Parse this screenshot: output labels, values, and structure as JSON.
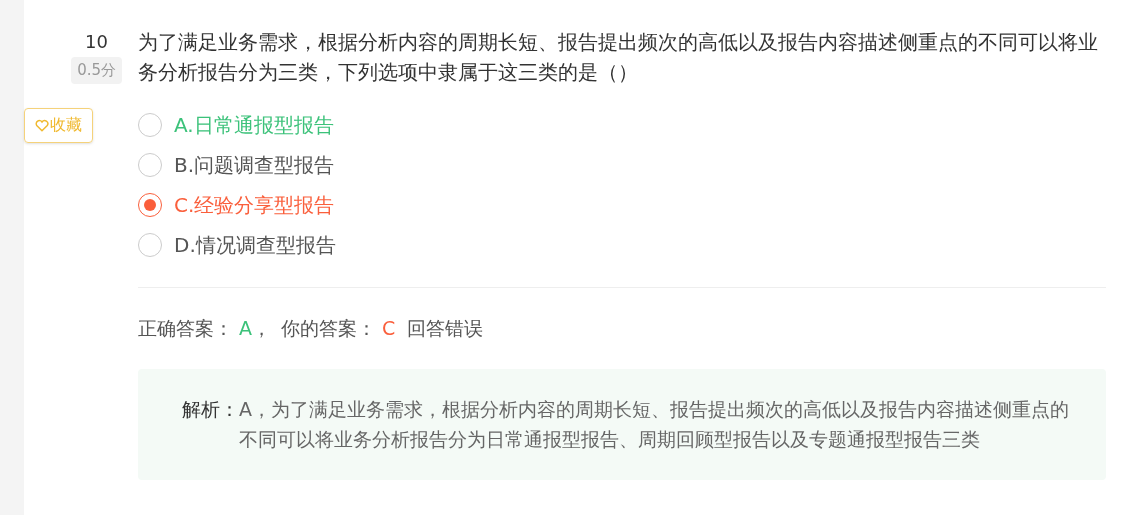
{
  "question": {
    "number": "10",
    "score": "0.5分",
    "text": "为了满足业务需求，根据分析内容的周期长短、报告提出频次的高低以及报告内容描述侧重点的不同可以将业务分析报告分为三类，下列选项中隶属于这三类的是（）"
  },
  "favorite_button": {
    "label": "收藏"
  },
  "options": [
    {
      "label": "A.日常通报型报告",
      "selected": false,
      "correct": true
    },
    {
      "label": "B.问题调查型报告",
      "selected": false,
      "correct": false
    },
    {
      "label": "C.经验分享型报告",
      "selected": true,
      "correct": false
    },
    {
      "label": "D.情况调查型报告",
      "selected": false,
      "correct": false
    }
  ],
  "result": {
    "correct_label": "正确答案：",
    "correct_answer": "A",
    "separator": "，",
    "your_label": "你的答案：",
    "your_answer": "C",
    "verdict": "回答错误"
  },
  "analysis": {
    "label": "解析：",
    "text": "A，为了满足业务需求，根据分析内容的周期长短、报告提出频次的高低以及报告内容描述侧重点的不同可以将业务分析报告分为日常通报型报告、周期回顾型报告以及专题通报型报告三类"
  }
}
